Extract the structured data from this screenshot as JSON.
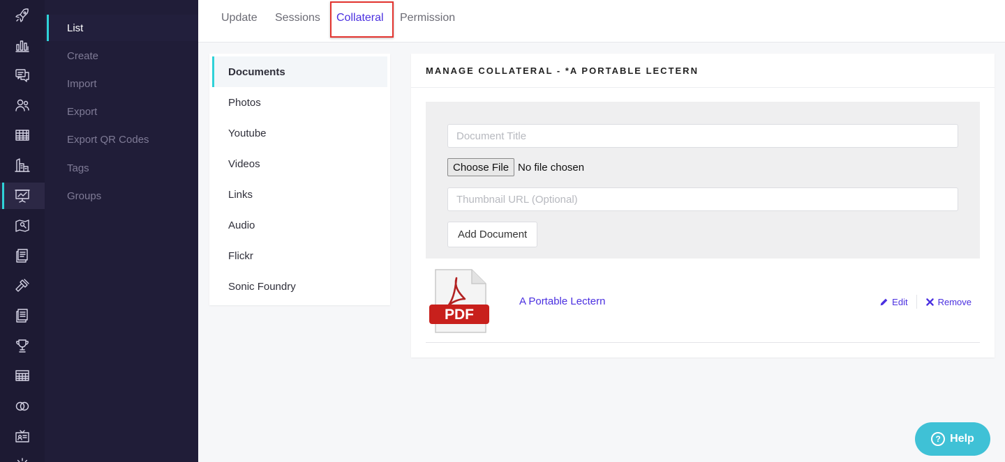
{
  "rail": {
    "items": [
      {
        "name": "rocket-icon"
      },
      {
        "name": "bar-chart-icon"
      },
      {
        "name": "chat-icon"
      },
      {
        "name": "users-icon"
      },
      {
        "name": "table-icon"
      },
      {
        "name": "building-icon"
      },
      {
        "name": "presentation-icon",
        "active": true
      },
      {
        "name": "map-icon"
      },
      {
        "name": "documents-icon"
      },
      {
        "name": "gavel-icon"
      },
      {
        "name": "pages-icon"
      },
      {
        "name": "trophy-icon"
      },
      {
        "name": "grid-icon"
      },
      {
        "name": "rings-icon"
      },
      {
        "name": "badge-icon"
      },
      {
        "name": "gear-icon"
      }
    ]
  },
  "subnav": {
    "items": [
      {
        "label": "List",
        "active": true
      },
      {
        "label": "Create"
      },
      {
        "label": "Import"
      },
      {
        "label": "Export"
      },
      {
        "label": "Export QR Codes"
      },
      {
        "label": "Tags"
      },
      {
        "label": "Groups"
      }
    ]
  },
  "tabs": [
    {
      "label": "Update"
    },
    {
      "label": "Sessions"
    },
    {
      "label": "Collateral",
      "active": true
    },
    {
      "label": "Permission"
    }
  ],
  "types": [
    {
      "label": "Documents",
      "active": true
    },
    {
      "label": "Photos"
    },
    {
      "label": "Youtube"
    },
    {
      "label": "Videos"
    },
    {
      "label": "Links"
    },
    {
      "label": "Audio"
    },
    {
      "label": "Flickr"
    },
    {
      "label": "Sonic Foundry"
    }
  ],
  "card": {
    "title": "MANAGE COLLATERAL - *A PORTABLE LECTERN",
    "form": {
      "title_placeholder": "Document Title",
      "file_button": "Choose File",
      "file_status": "No file chosen",
      "thumbnail_placeholder": "Thumbnail URL (Optional)",
      "add_button": "Add Document"
    },
    "documents": [
      {
        "icon_label": "PDF",
        "title": "A Portable Lectern",
        "edit_label": "Edit",
        "remove_label": "Remove"
      }
    ]
  },
  "help": {
    "icon_glyph": "?",
    "label": "Help"
  },
  "colors": {
    "accent": "#2fd2d8",
    "link": "#4a2fe0",
    "rail_bg": "#1d1a33",
    "help_bg": "#3fc1d6",
    "pdf_red": "#c8201c",
    "tab_highlight": "#e3342f"
  }
}
